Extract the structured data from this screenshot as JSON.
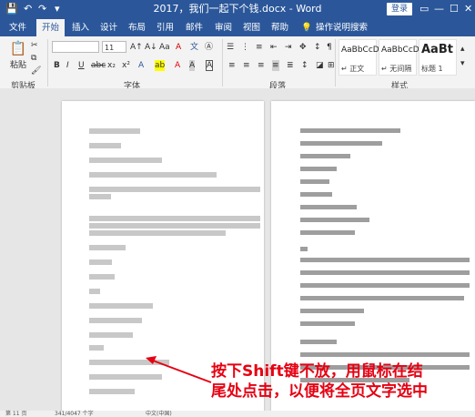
{
  "title_bar": {
    "title": "2017，我们一起下个钱.docx - Word",
    "login": "登录"
  },
  "tabs": [
    "文件",
    "开始",
    "插入",
    "设计",
    "布局",
    "引用",
    "邮件",
    "审阅",
    "视图",
    "帮助"
  ],
  "search_label": "操作说明搜索",
  "ribbon": {
    "paste_label": "粘贴",
    "font_name": "",
    "font_size": "11",
    "groups": [
      "剪贴板",
      "字体",
      "段落",
      "样式"
    ],
    "styles": [
      {
        "sample": "AaBbCcDt",
        "name": "↵ 正文"
      },
      {
        "sample": "AaBbCcDt",
        "name": "↵ 无间隔"
      },
      {
        "sample": "AaBt",
        "name": "标题 1"
      }
    ]
  },
  "annotation": {
    "line1": "按下Shift键不放，用鼠标在结",
    "line2": "尾处点击，以便将全页文字选中"
  },
  "status": {
    "page": "第 11 页",
    "words": "341/4047 个字",
    "lang": "中文(中国)"
  }
}
